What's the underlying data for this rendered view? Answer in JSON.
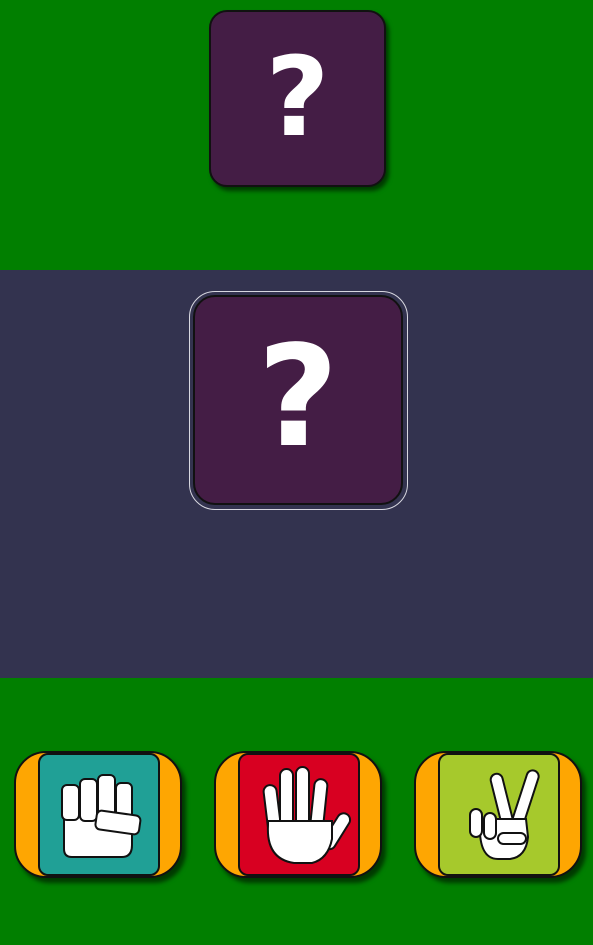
{
  "colors": {
    "top_background": "#017f00",
    "arena_background": "#33334f",
    "bottom_background": "#017f00",
    "card_face": "#441d45",
    "choice_frame": "#fea602",
    "rock_face": "#20a096",
    "paper_face": "#d80021",
    "scissors_face": "#a6c92c"
  },
  "opponent": {
    "symbol": "?",
    "icon": "question-mark"
  },
  "player": {
    "symbol": "?",
    "icon": "question-mark"
  },
  "choices": [
    {
      "id": "rock",
      "icon": "fist-icon"
    },
    {
      "id": "paper",
      "icon": "open-hand-icon"
    },
    {
      "id": "scissors",
      "icon": "victory-hand-icon"
    }
  ]
}
